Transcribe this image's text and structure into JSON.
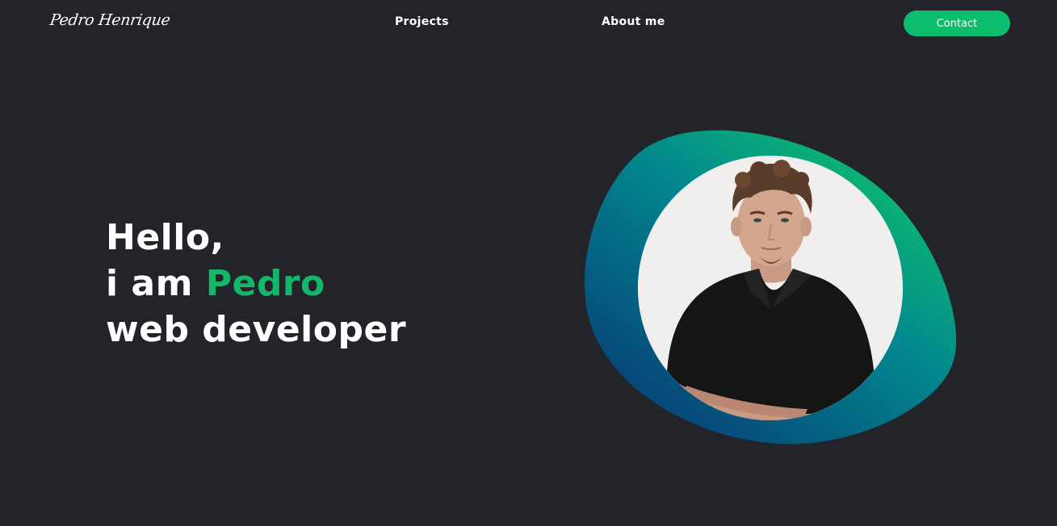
{
  "header": {
    "logo": "Pedro Henrique",
    "nav": {
      "projects": "Projects",
      "about": "About me"
    },
    "contact_label": "Contact"
  },
  "hero": {
    "line1": "Hello,",
    "line2_prefix": "i am ",
    "line2_name": "Pedro",
    "line3": "web developer"
  },
  "colors": {
    "background": "#232429",
    "accent": "#12b76a",
    "button": "#0dbd6e",
    "blob_gradient": [
      "#0dbd6e",
      "#02878f",
      "#064a7a"
    ]
  }
}
